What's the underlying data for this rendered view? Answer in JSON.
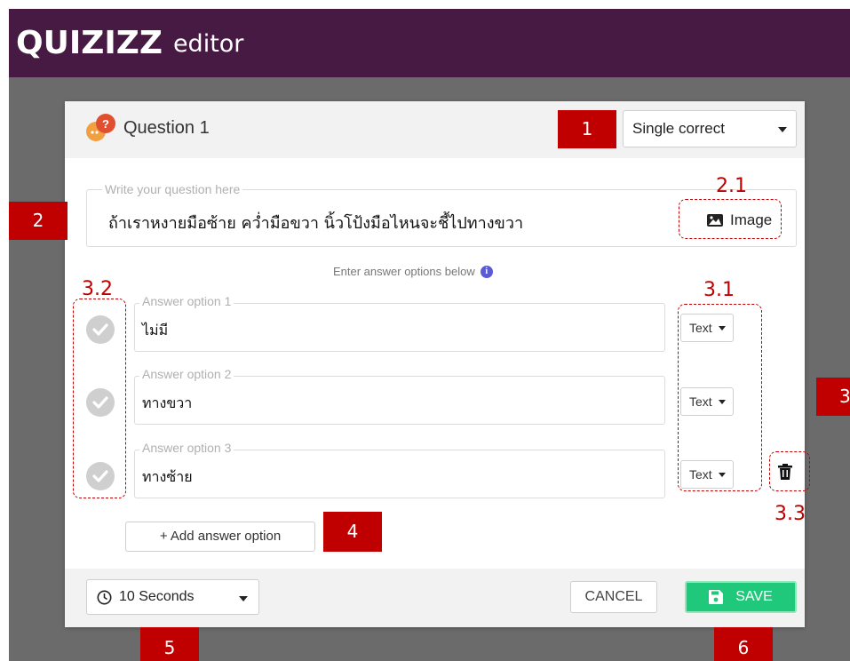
{
  "header": {
    "logo": "QUIZIZZ",
    "subtitle": "editor"
  },
  "question_card": {
    "title": "Question 1",
    "type_select": "Single correct",
    "question_placeholder": "Write your question here",
    "question_text": "ถ้าเราหงายมือซ้าย คว่ำมือขวา นิ้วโป้งมือไหนจะชี้ไปทางขวา",
    "image_button": "Image",
    "answers_hint": "Enter answer options below",
    "answers": [
      {
        "placeholder": "Answer option 1",
        "value": "ไม่มี",
        "type": "Text"
      },
      {
        "placeholder": "Answer option 2",
        "value": "ทางขวา",
        "type": "Text"
      },
      {
        "placeholder": "Answer option 3",
        "value": "ทางซ้าย",
        "type": "Text"
      }
    ],
    "add_answer_button": "+ Add answer option",
    "time_select": "10 Seconds",
    "cancel_button": "CANCEL",
    "save_button": "SAVE"
  },
  "annotations": {
    "m1": "1",
    "m2": "2",
    "m3": "3",
    "m4": "4",
    "m5": "5",
    "m6": "6",
    "l21": "2.1",
    "l31": "3.1",
    "l32": "3.2",
    "l33": "3.3"
  },
  "colors": {
    "header_bg": "#461a42",
    "backdrop": "#6b6b6b",
    "save_green": "#1fc87a",
    "annotation_red": "#c00000"
  }
}
